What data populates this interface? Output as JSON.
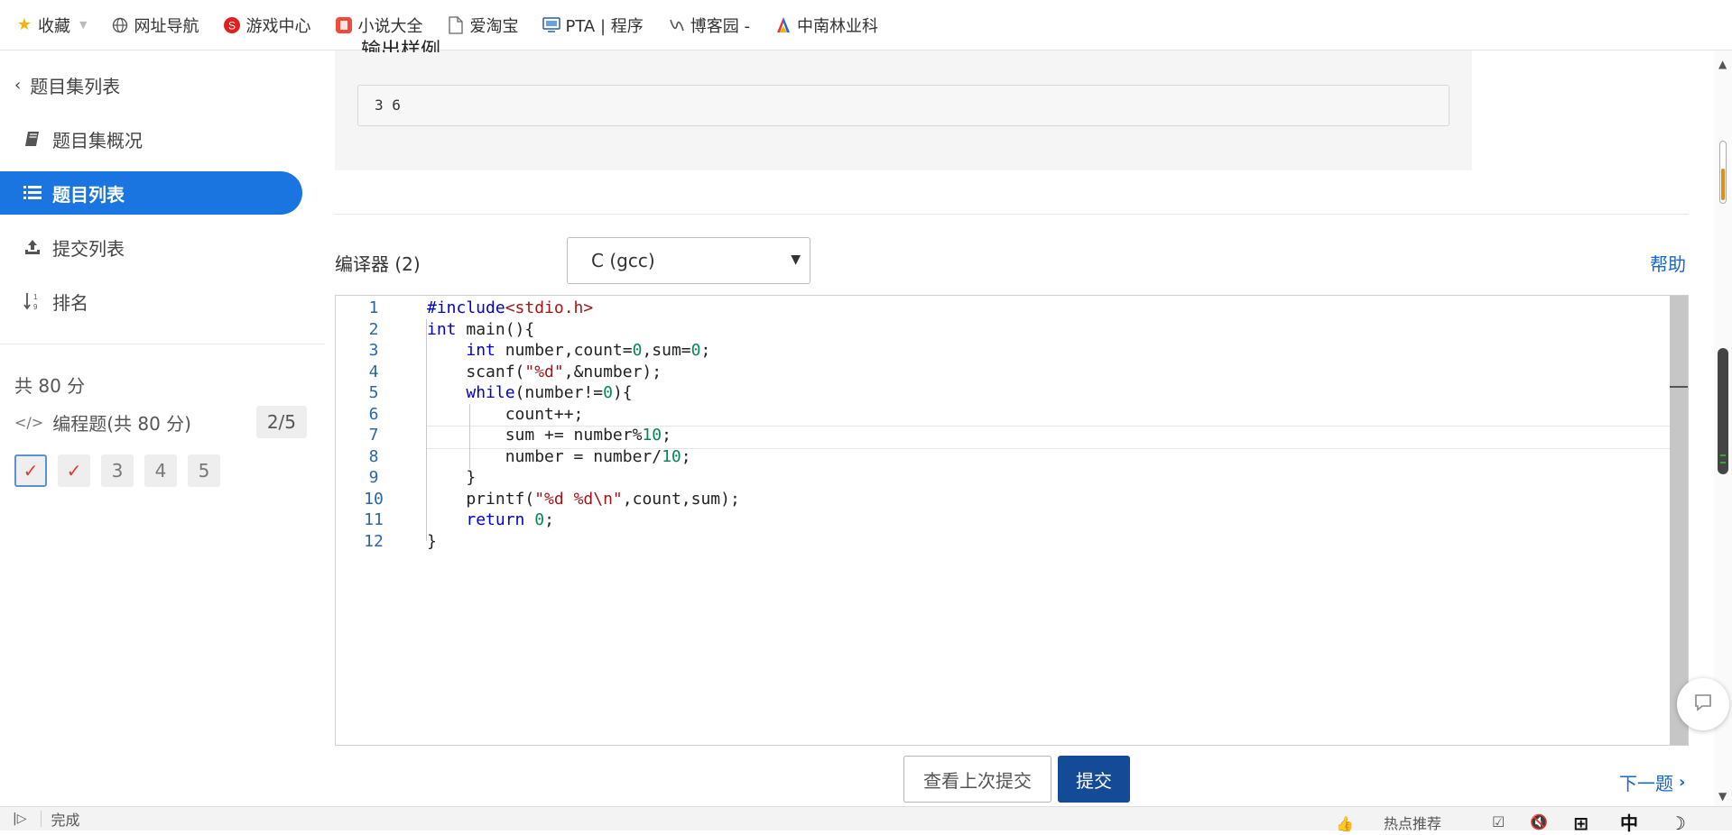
{
  "bookmarks": [
    {
      "label": "收藏",
      "icon": "star-icon"
    },
    {
      "label": "网址导航",
      "icon": "globe-icon"
    },
    {
      "label": "游戏中心",
      "icon": "game-icon"
    },
    {
      "label": "小说大全",
      "icon": "book-app-icon"
    },
    {
      "label": "爱淘宝",
      "icon": "page-icon"
    },
    {
      "label": "PTA | 程序",
      "icon": "pta-icon"
    },
    {
      "label": "博客园 -",
      "icon": "cnblogs-icon"
    },
    {
      "label": "中南林业科",
      "icon": "school-logo-icon"
    }
  ],
  "sidebar": {
    "back_label": "题目集列表",
    "items": [
      {
        "label": "题目集概况",
        "icon": "book-icon"
      },
      {
        "label": "题目列表",
        "icon": "list-icon"
      },
      {
        "label": "提交列表",
        "icon": "upload-icon"
      },
      {
        "label": "排名",
        "icon": "sort-numeric-icon"
      }
    ],
    "total": "共 80 分",
    "section_label": "编程题(共 80 分)",
    "section_progress": "2/5",
    "questions": [
      {
        "label": "1",
        "status": "done"
      },
      {
        "label": "2",
        "status": "done"
      },
      {
        "label": "3",
        "status": "todo"
      },
      {
        "label": "4",
        "status": "todo"
      },
      {
        "label": "5",
        "status": "todo"
      }
    ]
  },
  "sample": {
    "heading_partial": "输出样例",
    "output": "3 6"
  },
  "editor": {
    "compiler_label": "编译器 (2)",
    "compiler_value": "C (gcc)",
    "help": "帮助",
    "line_numbers": [
      "1",
      "2",
      "3",
      "4",
      "5",
      "6",
      "7",
      "8",
      "9",
      "10",
      "11",
      "12"
    ],
    "code": [
      "#include<stdio.h>",
      "int main(){",
      "    int number,count=0,sum=0;",
      "    scanf(\"%d\",&number);",
      "    while(number!=0){",
      "        count++;",
      "        sum += number%10;",
      "        number = number/10;",
      "    }",
      "    printf(\"%d %d\\n\",count,sum);",
      "    return 0;",
      "}"
    ]
  },
  "actions": {
    "view_last": "查看上次提交",
    "submit": "提交",
    "next": "下一题"
  },
  "statusbar": {
    "status": "完成",
    "hot": "热点推荐",
    "ime": "中"
  },
  "colors": {
    "accent": "#1a75e0",
    "submit_bg": "#154b96",
    "link": "#1a66cc",
    "check": "#e23b3b"
  }
}
